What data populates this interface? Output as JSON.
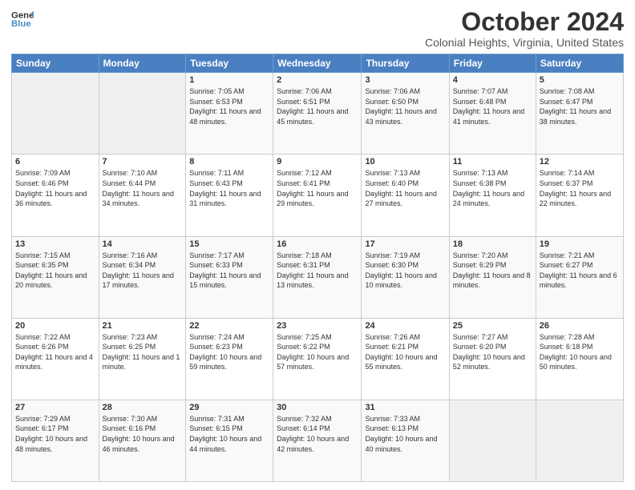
{
  "logo": {
    "line1": "General",
    "line2": "Blue"
  },
  "title": "October 2024",
  "subtitle": "Colonial Heights, Virginia, United States",
  "days_of_week": [
    "Sunday",
    "Monday",
    "Tuesday",
    "Wednesday",
    "Thursday",
    "Friday",
    "Saturday"
  ],
  "weeks": [
    [
      {
        "day": "",
        "info": ""
      },
      {
        "day": "",
        "info": ""
      },
      {
        "day": "1",
        "sunrise": "7:05 AM",
        "sunset": "6:53 PM",
        "daylight": "11 hours and 48 minutes."
      },
      {
        "day": "2",
        "sunrise": "7:06 AM",
        "sunset": "6:51 PM",
        "daylight": "11 hours and 45 minutes."
      },
      {
        "day": "3",
        "sunrise": "7:06 AM",
        "sunset": "6:50 PM",
        "daylight": "11 hours and 43 minutes."
      },
      {
        "day": "4",
        "sunrise": "7:07 AM",
        "sunset": "6:48 PM",
        "daylight": "11 hours and 41 minutes."
      },
      {
        "day": "5",
        "sunrise": "7:08 AM",
        "sunset": "6:47 PM",
        "daylight": "11 hours and 38 minutes."
      }
    ],
    [
      {
        "day": "6",
        "sunrise": "7:09 AM",
        "sunset": "6:46 PM",
        "daylight": "11 hours and 36 minutes."
      },
      {
        "day": "7",
        "sunrise": "7:10 AM",
        "sunset": "6:44 PM",
        "daylight": "11 hours and 34 minutes."
      },
      {
        "day": "8",
        "sunrise": "7:11 AM",
        "sunset": "6:43 PM",
        "daylight": "11 hours and 31 minutes."
      },
      {
        "day": "9",
        "sunrise": "7:12 AM",
        "sunset": "6:41 PM",
        "daylight": "11 hours and 29 minutes."
      },
      {
        "day": "10",
        "sunrise": "7:13 AM",
        "sunset": "6:40 PM",
        "daylight": "11 hours and 27 minutes."
      },
      {
        "day": "11",
        "sunrise": "7:13 AM",
        "sunset": "6:38 PM",
        "daylight": "11 hours and 24 minutes."
      },
      {
        "day": "12",
        "sunrise": "7:14 AM",
        "sunset": "6:37 PM",
        "daylight": "11 hours and 22 minutes."
      }
    ],
    [
      {
        "day": "13",
        "sunrise": "7:15 AM",
        "sunset": "6:35 PM",
        "daylight": "11 hours and 20 minutes."
      },
      {
        "day": "14",
        "sunrise": "7:16 AM",
        "sunset": "6:34 PM",
        "daylight": "11 hours and 17 minutes."
      },
      {
        "day": "15",
        "sunrise": "7:17 AM",
        "sunset": "6:33 PM",
        "daylight": "11 hours and 15 minutes."
      },
      {
        "day": "16",
        "sunrise": "7:18 AM",
        "sunset": "6:31 PM",
        "daylight": "11 hours and 13 minutes."
      },
      {
        "day": "17",
        "sunrise": "7:19 AM",
        "sunset": "6:30 PM",
        "daylight": "11 hours and 10 minutes."
      },
      {
        "day": "18",
        "sunrise": "7:20 AM",
        "sunset": "6:29 PM",
        "daylight": "11 hours and 8 minutes."
      },
      {
        "day": "19",
        "sunrise": "7:21 AM",
        "sunset": "6:27 PM",
        "daylight": "11 hours and 6 minutes."
      }
    ],
    [
      {
        "day": "20",
        "sunrise": "7:22 AM",
        "sunset": "6:26 PM",
        "daylight": "11 hours and 4 minutes."
      },
      {
        "day": "21",
        "sunrise": "7:23 AM",
        "sunset": "6:25 PM",
        "daylight": "11 hours and 1 minute."
      },
      {
        "day": "22",
        "sunrise": "7:24 AM",
        "sunset": "6:23 PM",
        "daylight": "10 hours and 59 minutes."
      },
      {
        "day": "23",
        "sunrise": "7:25 AM",
        "sunset": "6:22 PM",
        "daylight": "10 hours and 57 minutes."
      },
      {
        "day": "24",
        "sunrise": "7:26 AM",
        "sunset": "6:21 PM",
        "daylight": "10 hours and 55 minutes."
      },
      {
        "day": "25",
        "sunrise": "7:27 AM",
        "sunset": "6:20 PM",
        "daylight": "10 hours and 52 minutes."
      },
      {
        "day": "26",
        "sunrise": "7:28 AM",
        "sunset": "6:18 PM",
        "daylight": "10 hours and 50 minutes."
      }
    ],
    [
      {
        "day": "27",
        "sunrise": "7:29 AM",
        "sunset": "6:17 PM",
        "daylight": "10 hours and 48 minutes."
      },
      {
        "day": "28",
        "sunrise": "7:30 AM",
        "sunset": "6:16 PM",
        "daylight": "10 hours and 46 minutes."
      },
      {
        "day": "29",
        "sunrise": "7:31 AM",
        "sunset": "6:15 PM",
        "daylight": "10 hours and 44 minutes."
      },
      {
        "day": "30",
        "sunrise": "7:32 AM",
        "sunset": "6:14 PM",
        "daylight": "10 hours and 42 minutes."
      },
      {
        "day": "31",
        "sunrise": "7:33 AM",
        "sunset": "6:13 PM",
        "daylight": "10 hours and 40 minutes."
      },
      {
        "day": "",
        "info": ""
      },
      {
        "day": "",
        "info": ""
      }
    ]
  ]
}
